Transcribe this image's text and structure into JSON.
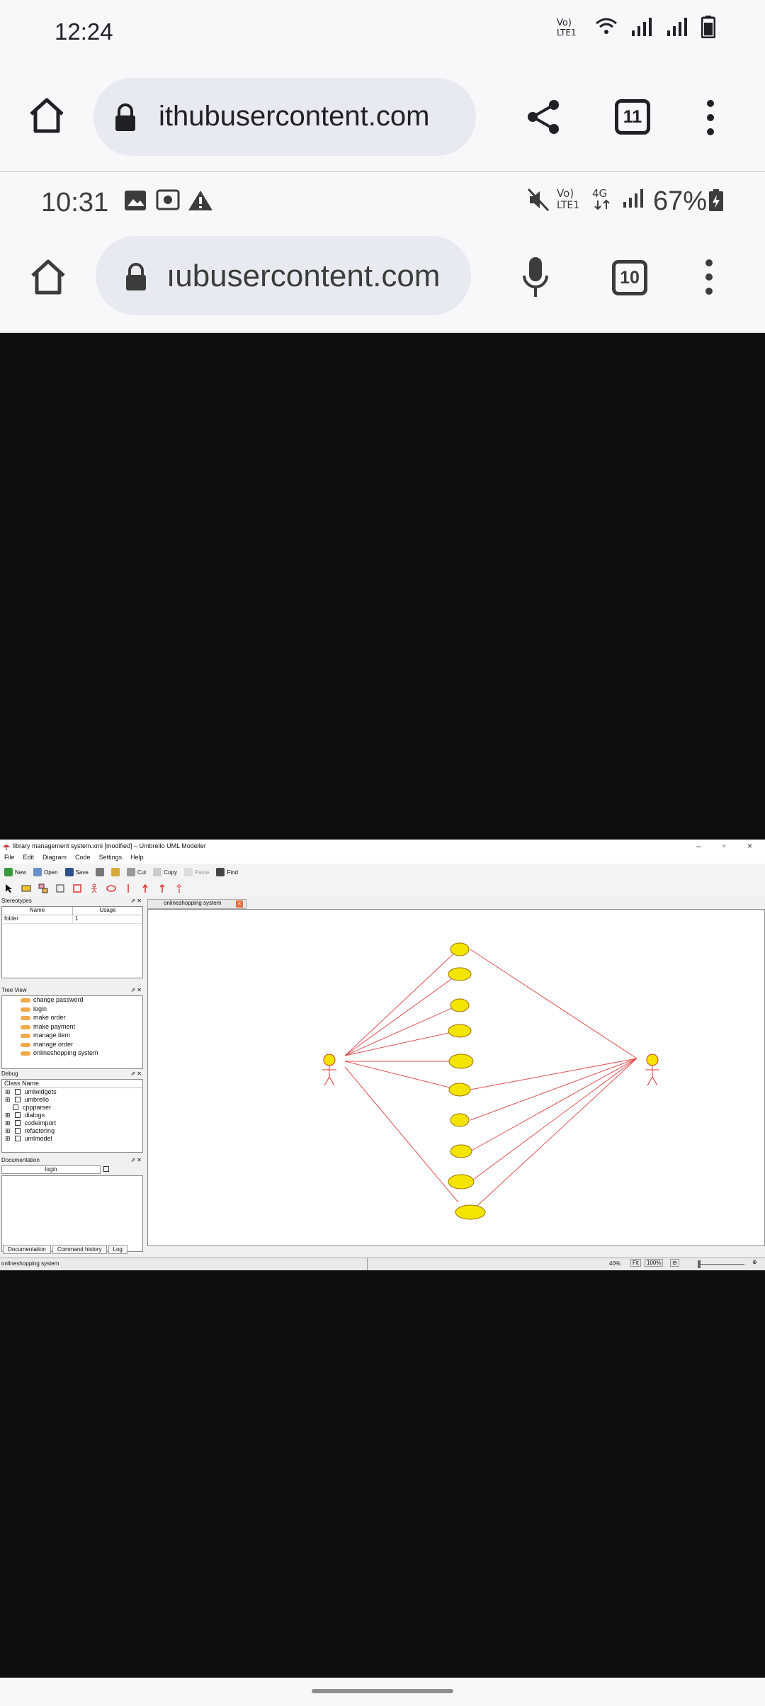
{
  "outer": {
    "time": "12:24",
    "url": "ithubusercontent.com",
    "tab_count": "11"
  },
  "inner": {
    "time": "10:31",
    "battery": "67%",
    "url": "ıubusercontent.com",
    "tab_count": "10"
  },
  "app": {
    "window_title": "library management system.xmi [modified] – Umbrello UML Modeller",
    "menu": [
      "File",
      "Edit",
      "Diagram",
      "Code",
      "Settings",
      "Help"
    ],
    "toolbar": [
      "New",
      "Open",
      "Save",
      "Cut",
      "Copy",
      "Paste",
      "Find"
    ],
    "stereotypes": {
      "title": "Stereotypes",
      "headers": [
        "Name",
        "Usage"
      ],
      "rows": [
        {
          "name": "folder",
          "usage": "1"
        }
      ]
    },
    "tree_view": {
      "title": "Tree View",
      "items": [
        "change password",
        "login",
        "make order",
        "make payment",
        "manage item",
        "manage order",
        "onlineshopping system"
      ]
    },
    "debug": {
      "title": "Debug",
      "header": "Class Name",
      "rows": [
        "umlwidgets",
        "umbrello",
        "cppparser",
        "dialogs",
        "codeimport",
        "refactoring",
        "umlmodel"
      ]
    },
    "documentation": {
      "title": "Documentation",
      "value": "login"
    },
    "bottom_tabs": [
      "Documentation",
      "Command history",
      "Log"
    ],
    "canvas_tab": "onlineshopping system",
    "status_left": "onlineshopping system",
    "zoom": "40%",
    "fit": "Fit",
    "zoom100": "100%"
  }
}
